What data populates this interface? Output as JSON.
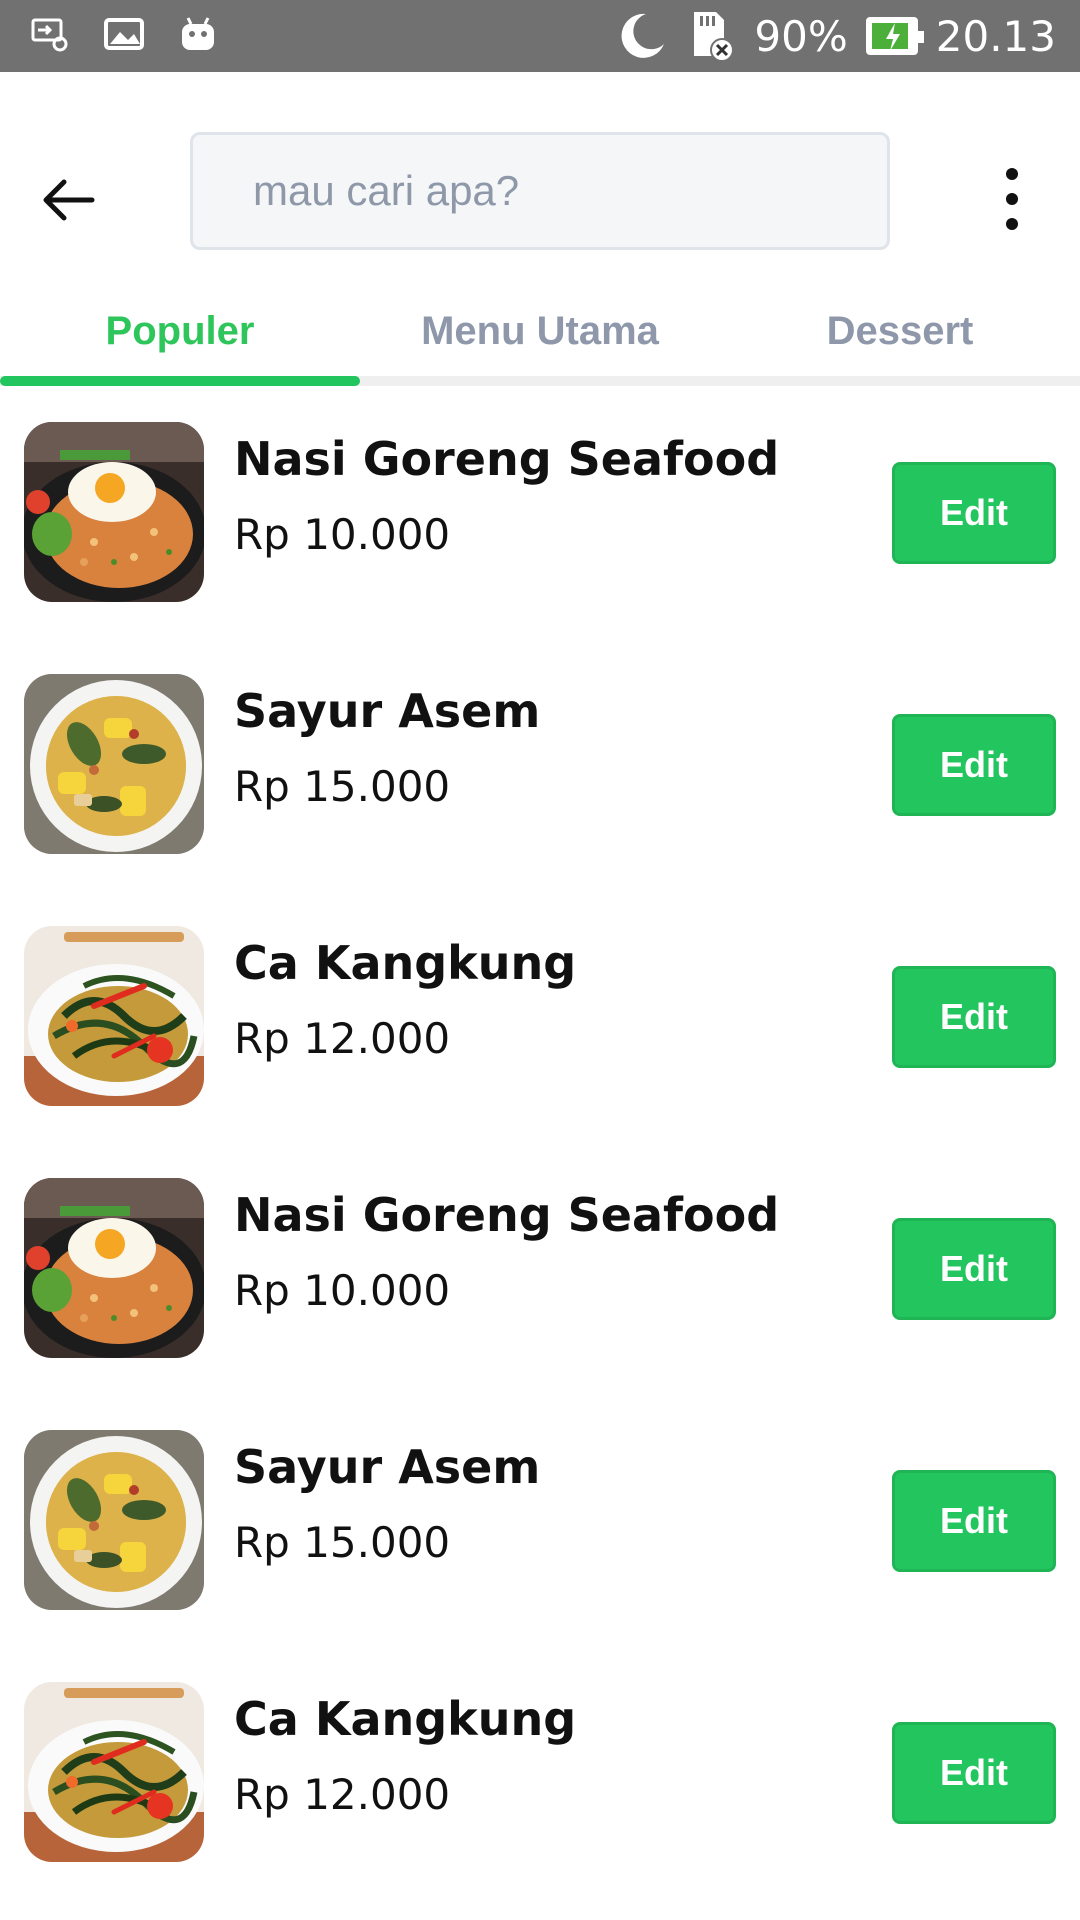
{
  "status_bar": {
    "battery_percent": "90%",
    "time": "20.13",
    "battery_level": 0.9,
    "icons": [
      "screen-cast-icon",
      "gallery-icon",
      "android-icon",
      "moon-icon",
      "sd-card-error-icon",
      "battery-charging-icon"
    ]
  },
  "header": {
    "search_placeholder": "mau cari apa?",
    "back_icon": "arrow-left-icon",
    "more_icon": "more-vertical-icon"
  },
  "tabs": [
    {
      "label": "Populer",
      "active": true
    },
    {
      "label": "Menu Utama",
      "active": false
    },
    {
      "label": "Dessert",
      "active": false
    }
  ],
  "colors": {
    "accent": "#22c55e",
    "tab_inactive": "#8e98aa",
    "status_bar": "#717171"
  },
  "items": [
    {
      "name": "Nasi Goreng Seafood",
      "price": "Rp 10.000",
      "button": "Edit",
      "image": "nasi-goreng"
    },
    {
      "name": "Sayur Asem",
      "price": "Rp 15.000",
      "button": "Edit",
      "image": "sayur-asem"
    },
    {
      "name": "Ca Kangkung",
      "price": "Rp 12.000",
      "button": "Edit",
      "image": "ca-kangkung"
    },
    {
      "name": "Nasi Goreng Seafood",
      "price": "Rp 10.000",
      "button": "Edit",
      "image": "nasi-goreng"
    },
    {
      "name": "Sayur Asem",
      "price": "Rp 15.000",
      "button": "Edit",
      "image": "sayur-asem"
    },
    {
      "name": "Ca Kangkung",
      "price": "Rp 12.000",
      "button": "Edit",
      "image": "ca-kangkung"
    }
  ]
}
